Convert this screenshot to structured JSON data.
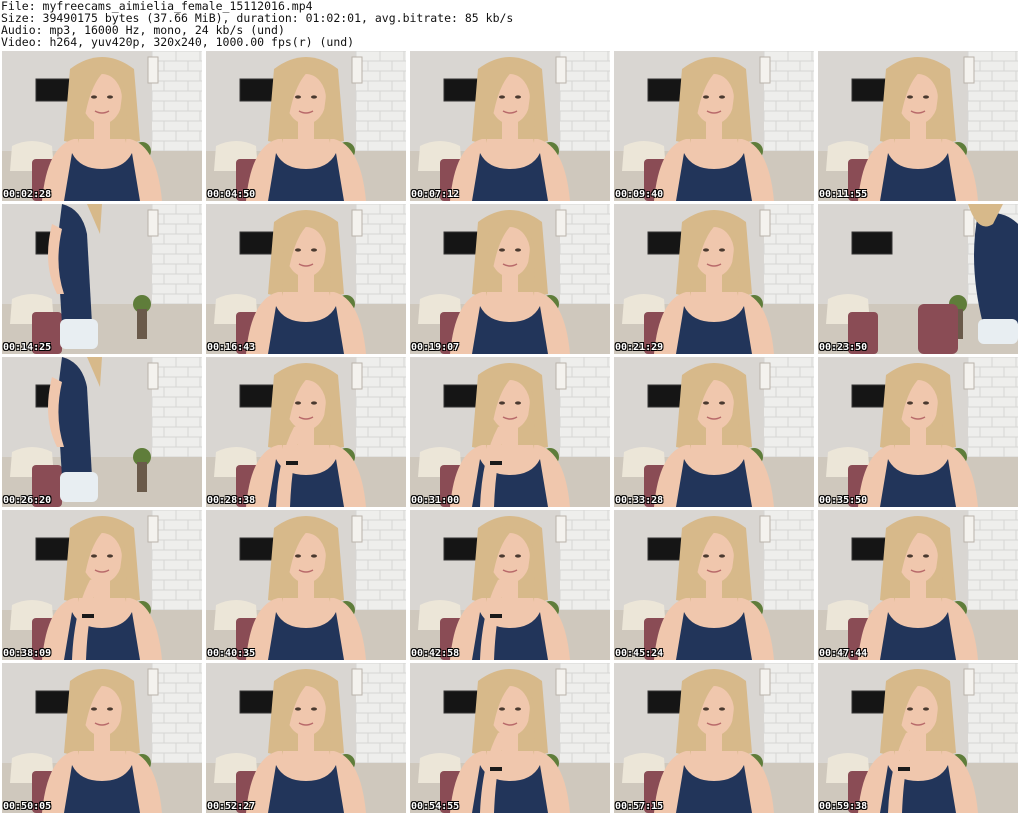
{
  "header": {
    "file_line": "File: myfreecams_aimielia_female_15112016.mp4",
    "size_line": "Size: 39490175 bytes (37.66 MiB), duration: 01:02:01, avg.bitrate: 85 kb/s",
    "audio_line": "Audio: mp3, 16000 Hz, mono, 24 kb/s (und)",
    "video_line": "Video: h264, yuv420p, 320x240, 1000.00 fps(r) (und)"
  },
  "thumbnails": [
    {
      "time": "00:02:28",
      "pose": "center"
    },
    {
      "time": "00:04:50",
      "pose": "center"
    },
    {
      "time": "00:07:12",
      "pose": "center"
    },
    {
      "time": "00:09:40",
      "pose": "center"
    },
    {
      "time": "00:11:55",
      "pose": "center"
    },
    {
      "time": "00:14:25",
      "pose": "left-side"
    },
    {
      "time": "00:16:43",
      "pose": "center"
    },
    {
      "time": "00:19:07",
      "pose": "center"
    },
    {
      "time": "00:21:29",
      "pose": "center"
    },
    {
      "time": "00:23:50",
      "pose": "right-side"
    },
    {
      "time": "00:26:20",
      "pose": "left-side"
    },
    {
      "time": "00:28:38",
      "pose": "center-hand"
    },
    {
      "time": "00:31:00",
      "pose": "center-hand"
    },
    {
      "time": "00:33:28",
      "pose": "center"
    },
    {
      "time": "00:35:50",
      "pose": "center"
    },
    {
      "time": "00:38:09",
      "pose": "center-hand"
    },
    {
      "time": "00:40:35",
      "pose": "center"
    },
    {
      "time": "00:42:58",
      "pose": "center-hand"
    },
    {
      "time": "00:45:24",
      "pose": "center"
    },
    {
      "time": "00:47:44",
      "pose": "center"
    },
    {
      "time": "00:50:05",
      "pose": "center"
    },
    {
      "time": "00:52:27",
      "pose": "center"
    },
    {
      "time": "00:54:55",
      "pose": "center-hand"
    },
    {
      "time": "00:57:15",
      "pose": "center"
    },
    {
      "time": "00:59:38",
      "pose": "center-hand"
    }
  ]
}
